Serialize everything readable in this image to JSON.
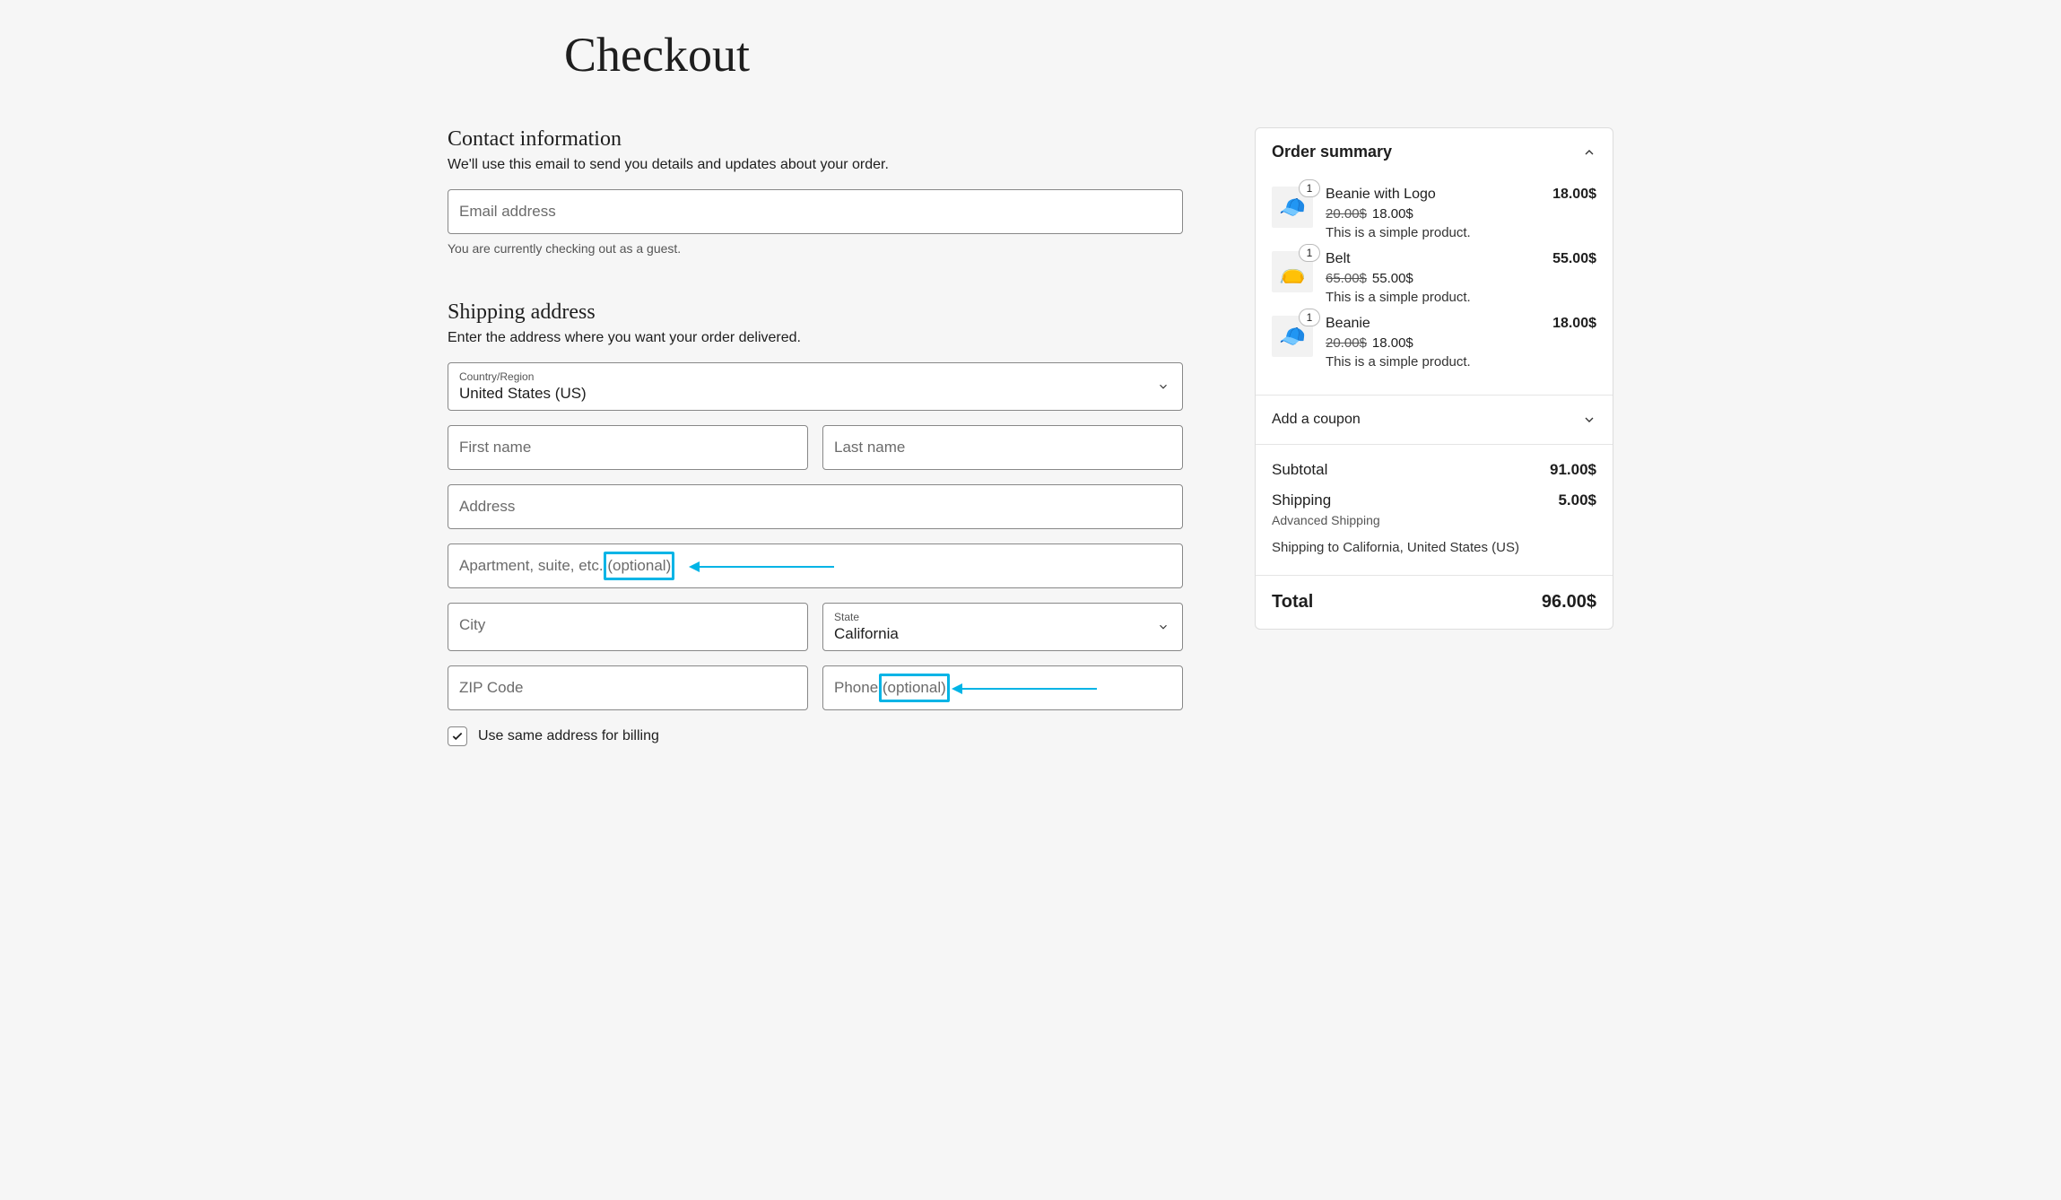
{
  "page": {
    "title": "Checkout"
  },
  "contact": {
    "heading": "Contact information",
    "sub": "We'll use this email to send you details and updates about your order.",
    "email_placeholder": "Email address",
    "guest_note": "You are currently checking out as a guest."
  },
  "shipping": {
    "heading": "Shipping address",
    "sub": "Enter the address where you want your order delivered.",
    "country_label": "Country/Region",
    "country_value": "United States (US)",
    "first_name": "First name",
    "last_name": "Last name",
    "address": "Address",
    "apt": "Apartment, suite, etc. ",
    "apt_optional": "(optional)",
    "city": "City",
    "state_label": "State",
    "state_value": "California",
    "zip": "ZIP Code",
    "phone": "Phone ",
    "phone_optional": "(optional)",
    "same_billing": "Use same address for billing"
  },
  "order": {
    "heading": "Order summary",
    "items": [
      {
        "qty": "1",
        "name": "Beanie with Logo",
        "old_price": "20.00$",
        "price": "18.00$",
        "desc": "This is a simple product.",
        "total": "18.00$",
        "emoji": "🧢",
        "color": "#a8d4e8"
      },
      {
        "qty": "1",
        "name": "Belt",
        "old_price": "65.00$",
        "price": "55.00$",
        "desc": "This is a simple product.",
        "total": "55.00$",
        "emoji": "👝",
        "color": "#c9a87a"
      },
      {
        "qty": "1",
        "name": "Beanie",
        "old_price": "20.00$",
        "price": "18.00$",
        "desc": "This is a simple product.",
        "total": "18.00$",
        "emoji": "🧢",
        "color": "#f2a896"
      }
    ],
    "coupon": "Add a coupon",
    "subtotal_label": "Subtotal",
    "subtotal": "91.00$",
    "shipping_label": "Shipping",
    "shipping": "5.00$",
    "shipping_method": "Advanced Shipping",
    "shipping_to": "Shipping to California, United States (US)",
    "total_label": "Total",
    "total": "96.00$"
  }
}
